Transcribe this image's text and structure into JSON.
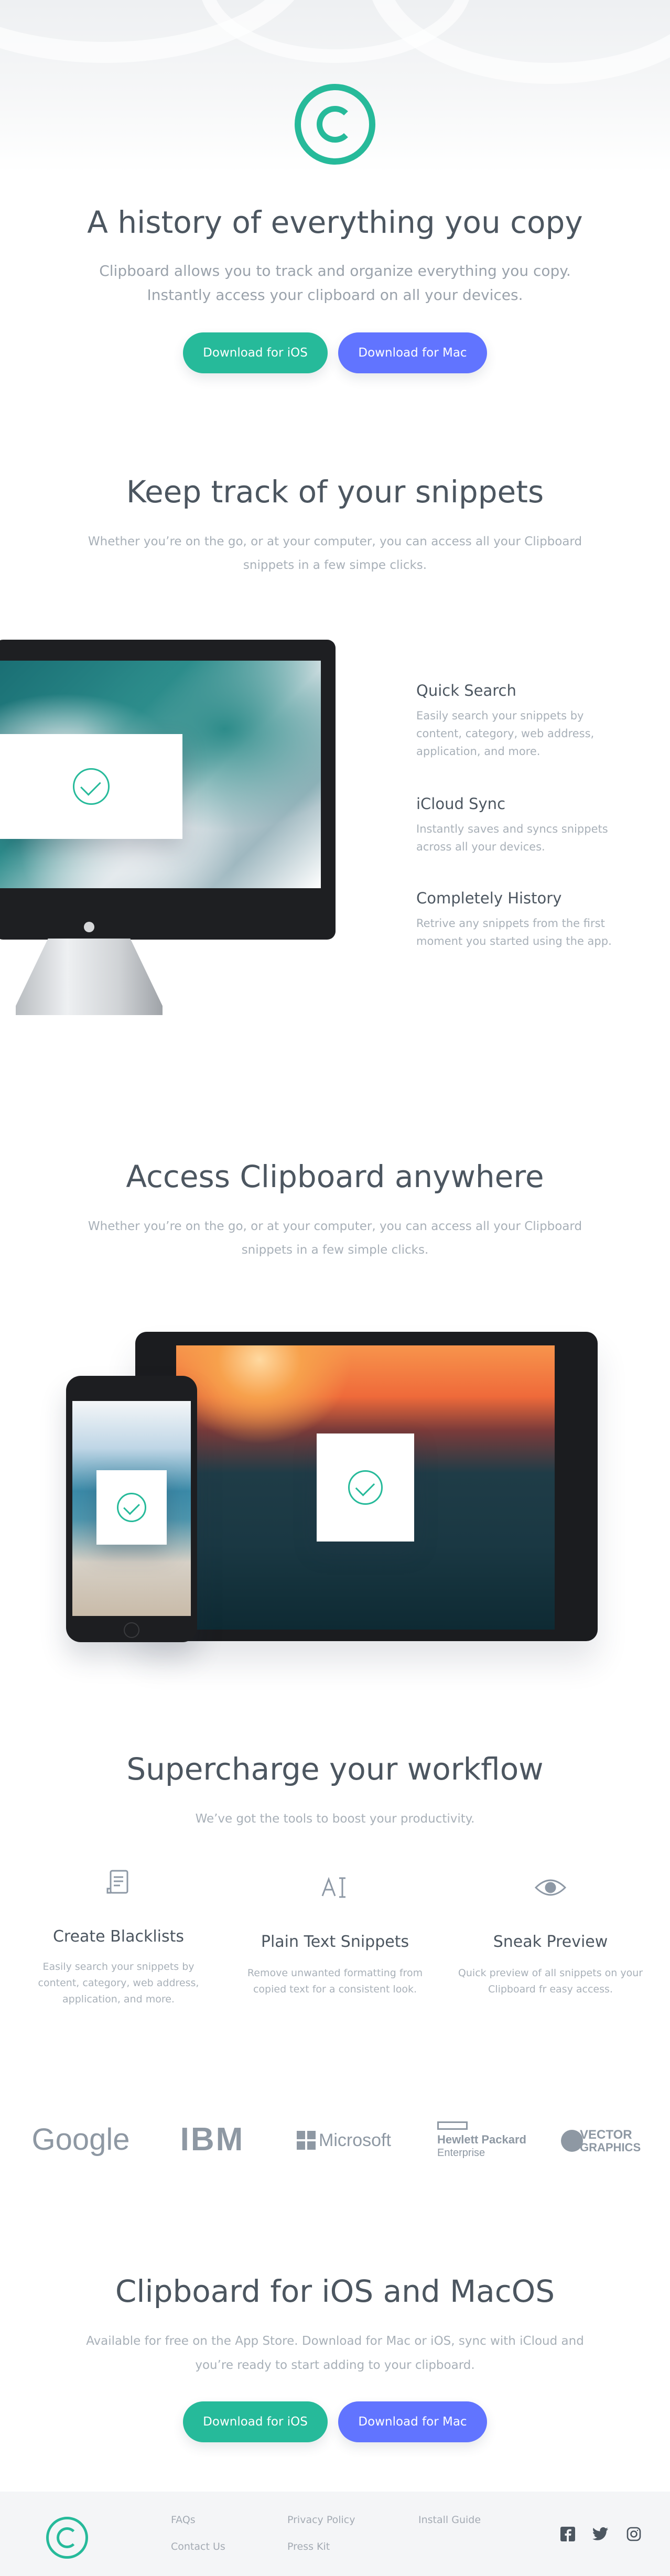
{
  "colors": {
    "accent": "#26ba9a",
    "mac": "#6174ff",
    "heading": "#4c5660",
    "muted": "#a8b0b8"
  },
  "hero": {
    "title": "A history of everything you copy",
    "lead_line1": "Clipboard allows you to track and organize everything you copy.",
    "lead_line2": "Instantly access your clipboard on all your devices.",
    "btn_ios": "Download for iOS",
    "btn_mac": "Download for Mac"
  },
  "snippets": {
    "title": "Keep track of your snippets",
    "sub_line1": "Whether you’re on the go, or at your computer, you can access all your Clipboard",
    "sub_line2": "snippets in a few simpe clicks.",
    "features": [
      {
        "title": "Quick Search",
        "lines": [
          "Easily search your snippets by",
          "content, category, web address,",
          "application, and more."
        ]
      },
      {
        "title": "iCloud Sync",
        "lines": [
          "Instantly saves and syncs snippets",
          "across all your devices."
        ]
      },
      {
        "title": "Completely History",
        "lines": [
          "Retrive any snippets from the first",
          "moment you started using the app."
        ]
      }
    ]
  },
  "access": {
    "title": "Access Clipboard anywhere",
    "sub_line1": "Whether you’re on the go, or at your computer, you can access all your Clipboard",
    "sub_line2": "snippets in a few simple clicks."
  },
  "workflow": {
    "title": "Supercharge your workflow",
    "sub": "We’ve got the tools to boost your productivity.",
    "items": [
      {
        "icon": "blacklist-icon",
        "title": "Create Blacklists",
        "lines": [
          "Easily search your snippets by",
          "content, category, web address,",
          "application, and more."
        ]
      },
      {
        "icon": "text-icon",
        "title": "Plain Text Snippets",
        "lines": [
          "Remove unwanted formatting from",
          "copied text for a consistent look."
        ]
      },
      {
        "icon": "eye-icon",
        "title": "Sneak Preview",
        "lines": [
          "Quick preview of all snippets on your",
          "Clipboard fr easy access."
        ]
      }
    ]
  },
  "brands": {
    "google": "Google",
    "ibm": "IBM",
    "microsoft": "Microsoft",
    "hp_line1": "Hewlett Packard",
    "hp_line2": "Enterprise",
    "vector_line1": "VECTOR",
    "vector_line2": "GRAPHICS"
  },
  "cta": {
    "title": "Clipboard for iOS and MacOS",
    "sub_line1": "Available for free on the App Store. Download for Mac or iOS, sync with iCloud and",
    "sub_line2": "you’re ready to start adding to your clipboard.",
    "btn_ios": "Download for iOS",
    "btn_mac": "Download for Mac"
  },
  "footer": {
    "links": [
      "FAQs",
      "Contact Us",
      "Privacy Policy",
      "Press Kit",
      "Install Guide"
    ],
    "social": [
      "facebook-icon",
      "twitter-icon",
      "instagram-icon"
    ]
  }
}
